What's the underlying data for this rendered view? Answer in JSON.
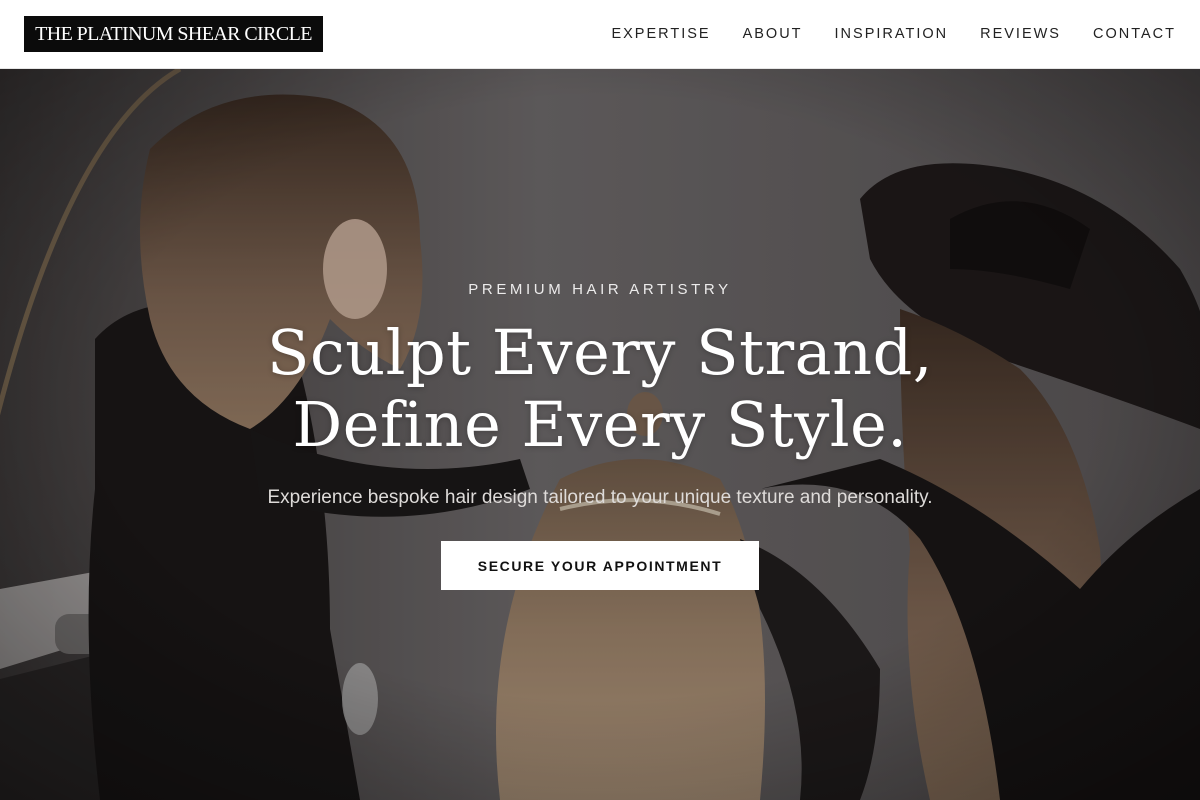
{
  "header": {
    "logo_text": "THE PLATINUM SHEAR CIRCLE",
    "nav": [
      {
        "label": "EXPERTISE"
      },
      {
        "label": "ABOUT"
      },
      {
        "label": "INSPIRATION"
      },
      {
        "label": "REVIEWS"
      },
      {
        "label": "CONTACT"
      }
    ]
  },
  "hero": {
    "eyebrow": "PREMIUM HAIR ARTISTRY",
    "headline_line1": "Sculpt Every Strand,",
    "headline_line2": "Define Every Style.",
    "subtext": "Experience bespoke hair design tailored to your unique texture and personality.",
    "cta_label": "SECURE YOUR APPOINTMENT"
  },
  "colors": {
    "logo_background": "#0b0b0b",
    "nav_text": "#222222",
    "hero_text": "#ffffff",
    "cta_background": "#ffffff",
    "cta_text": "#111111"
  }
}
